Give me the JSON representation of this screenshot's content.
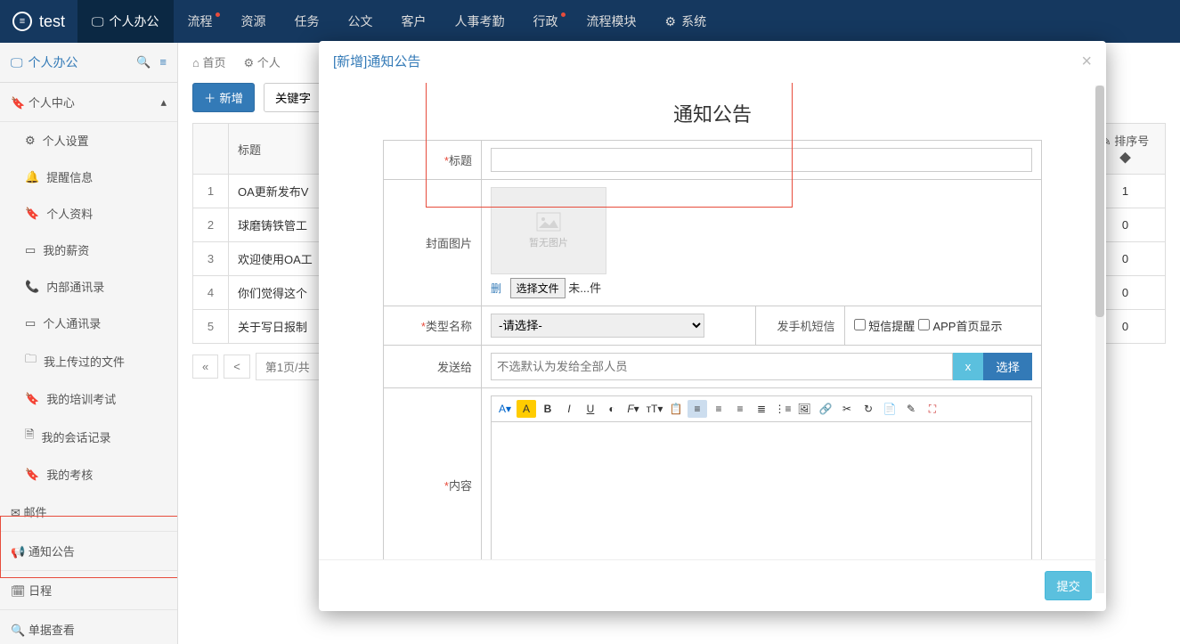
{
  "brand": "test",
  "topnav": [
    {
      "label": "个人办公",
      "active": true,
      "icon": "monitor"
    },
    {
      "label": "流程",
      "dot": true
    },
    {
      "label": "资源"
    },
    {
      "label": "任务"
    },
    {
      "label": "公文"
    },
    {
      "label": "客户"
    },
    {
      "label": "人事考勤"
    },
    {
      "label": "行政",
      "dot": true
    },
    {
      "label": "流程模块"
    },
    {
      "label": "系统",
      "icon": "gear"
    }
  ],
  "sidebar": {
    "title": "个人办公",
    "group": "个人中心",
    "items": [
      {
        "label": "个人设置",
        "icon": "gear"
      },
      {
        "label": "提醒信息",
        "icon": "bell"
      },
      {
        "label": "个人资料",
        "icon": "bookmark"
      },
      {
        "label": "我的薪资",
        "icon": "card"
      },
      {
        "label": "内部通讯录",
        "icon": "phone"
      },
      {
        "label": "个人通讯录",
        "icon": "book"
      },
      {
        "label": "我上传过的文件",
        "icon": "folder"
      },
      {
        "label": "我的培训考试",
        "icon": "bookmark"
      },
      {
        "label": "我的会话记录",
        "icon": "file"
      },
      {
        "label": "我的考核",
        "icon": "bookmark"
      }
    ],
    "groups2": [
      {
        "label": "邮件",
        "icon": "mail"
      },
      {
        "label": "通知公告",
        "icon": "sound"
      },
      {
        "label": "日程",
        "icon": "calendar"
      },
      {
        "label": "单据查看",
        "icon": "search"
      }
    ]
  },
  "breadcrumb": {
    "home": "首页",
    "page": "个人"
  },
  "toolbar": {
    "add": "新增",
    "keyword": "关键字"
  },
  "table": {
    "headers": {
      "title": "标题",
      "sort": "排序号"
    },
    "rows": [
      {
        "n": "1",
        "title": "OA更新发布V",
        "sort": "1"
      },
      {
        "n": "2",
        "title": "球磨铸铁管工",
        "sort": "0"
      },
      {
        "n": "3",
        "title": "欢迎使用OA工",
        "sort": "0"
      },
      {
        "n": "4",
        "title": "你们觉得这个",
        "sort": "0"
      },
      {
        "n": "5",
        "title": "关于写日报制",
        "sort": "0"
      }
    ]
  },
  "pager": {
    "prev": "«",
    "prev2": "<",
    "info": "第1页/共"
  },
  "modal": {
    "header": "[新增]通知公告",
    "title": "通知公告",
    "fields": {
      "title_label": "标题",
      "cover_label": "封面图片",
      "cover_placeholder": "暂无图片",
      "del": "删",
      "choose_file": "选择文件",
      "file_status": "未...件",
      "type_label": "类型名称",
      "type_placeholder": "-请选择-",
      "sms_label": "发手机短信",
      "sms_cb": "短信提醒",
      "app_cb": "APP首页显示",
      "sendto_label": "发送给",
      "sendto_placeholder": "不选默认为发给全部人员",
      "x": "x",
      "choose": "选择",
      "content_label": "内容"
    },
    "submit": "提交"
  }
}
